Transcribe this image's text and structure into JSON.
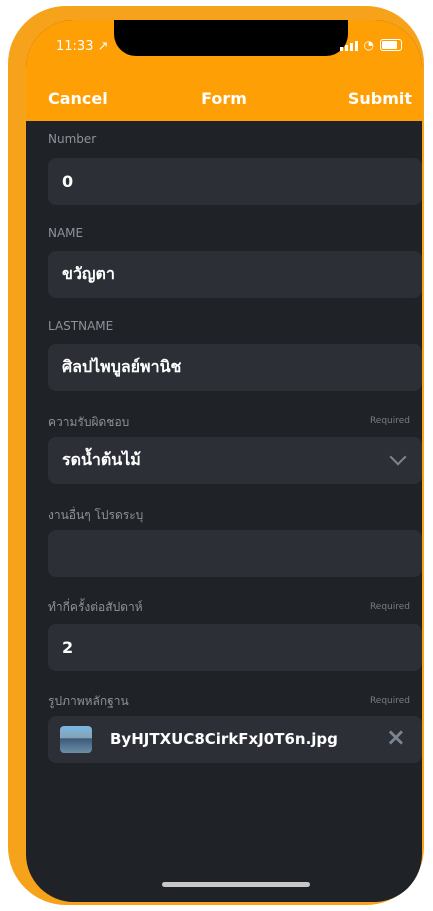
{
  "status_bar": {
    "time": "11:33 ↗"
  },
  "navbar": {
    "cancel_label": "Cancel",
    "title": "Form",
    "submit_label": "Submit"
  },
  "form": {
    "fields": [
      {
        "label": "Number",
        "value": "0",
        "required": ""
      },
      {
        "label": "NAME",
        "value": "ขวัญตา",
        "required": ""
      },
      {
        "label": "LASTNAME",
        "value": "ศิลปไพบูลย์พานิช",
        "required": ""
      },
      {
        "label": "ความรับผิดชอบ",
        "value": "รดน้ำต้นไม้",
        "required": "Required"
      },
      {
        "label": "งานอื่นๆ โปรดระบุ",
        "value": "",
        "required": ""
      },
      {
        "label": "ทำกี่ครั้งต่อสัปดาห์",
        "value": "2",
        "required": "Required"
      },
      {
        "label": "รูปภาพหลักฐาน",
        "value": "ByHJTXUC8CirkFxJ0T6n.jpg",
        "required": "Required"
      }
    ]
  },
  "icons": {
    "dropdown": "chevron-down-icon",
    "remove_file": "close-icon",
    "attachment": "image-thumbnail-icon"
  },
  "colors": {
    "accent": "#ff9f06",
    "background": "#1f2226",
    "field": "#2c3036"
  }
}
